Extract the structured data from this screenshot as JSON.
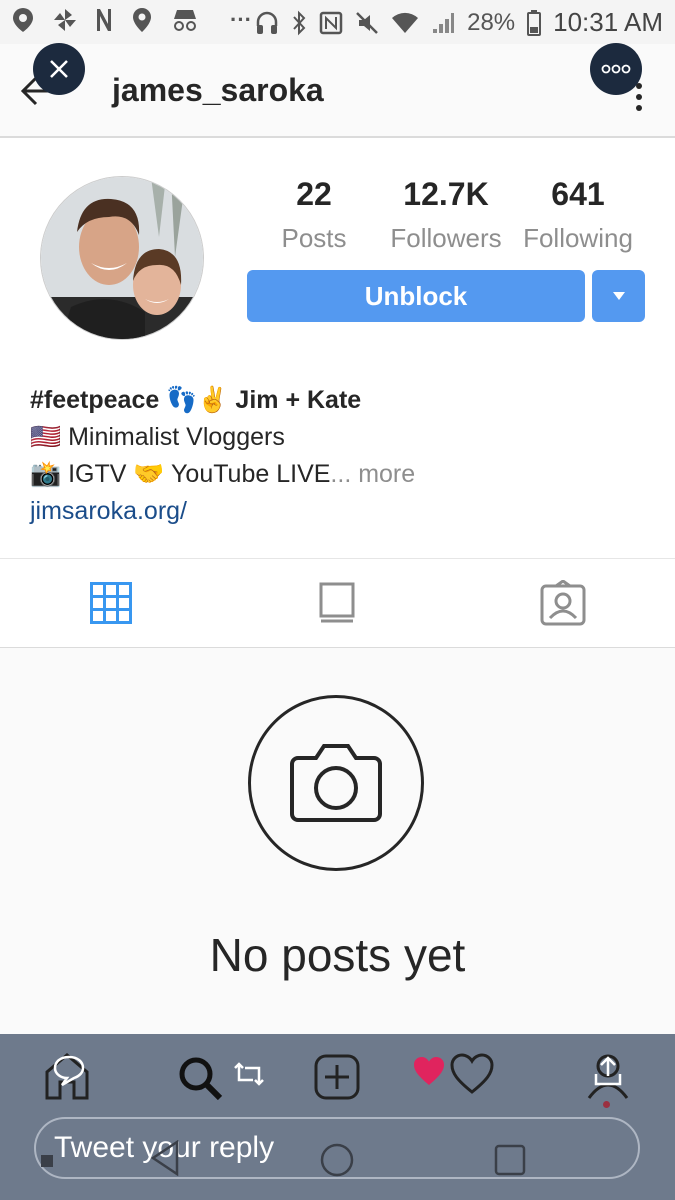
{
  "status_bar": {
    "battery": "28%",
    "time": "10:31 AM",
    "extra": "···"
  },
  "header": {
    "username": "james_saroka",
    "back_icon": "arrow-left-icon",
    "menu_icon": "more-vertical-icon"
  },
  "overlay": {
    "close_icon": "close-icon",
    "more_icon": "more-horizontal-icon"
  },
  "profile": {
    "stats": [
      {
        "value": "22",
        "label": "Posts"
      },
      {
        "value": "12.7K",
        "label": "Followers"
      },
      {
        "value": "641",
        "label": "Following"
      }
    ],
    "unblock_label": "Unblock",
    "bio": {
      "line1_tag": "#feetpeace",
      "line1_emoji": "👣✌",
      "line1_names": "Jim + Kate",
      "line2_flag": "🇺🇸",
      "line2_text": "Minimalist Vloggers",
      "line3_icon": "📸",
      "line3_text_a": "IGTV",
      "line3_emoji": "🤝",
      "line3_text_b": "YouTube LIVE",
      "line3_more": "... more",
      "link": "jimsaroka.org/"
    }
  },
  "tabs": [
    "grid-icon",
    "igtv-icon",
    "tagged-icon"
  ],
  "empty_state": {
    "message": "No posts yet"
  },
  "twitter_bar": {
    "reply_placeholder": "Tweet your reply",
    "colors": {
      "like": "#e0245e",
      "bar": "#6e7a8c"
    }
  },
  "colors": {
    "accent": "#5499f0",
    "link": "#1b4d8a"
  }
}
